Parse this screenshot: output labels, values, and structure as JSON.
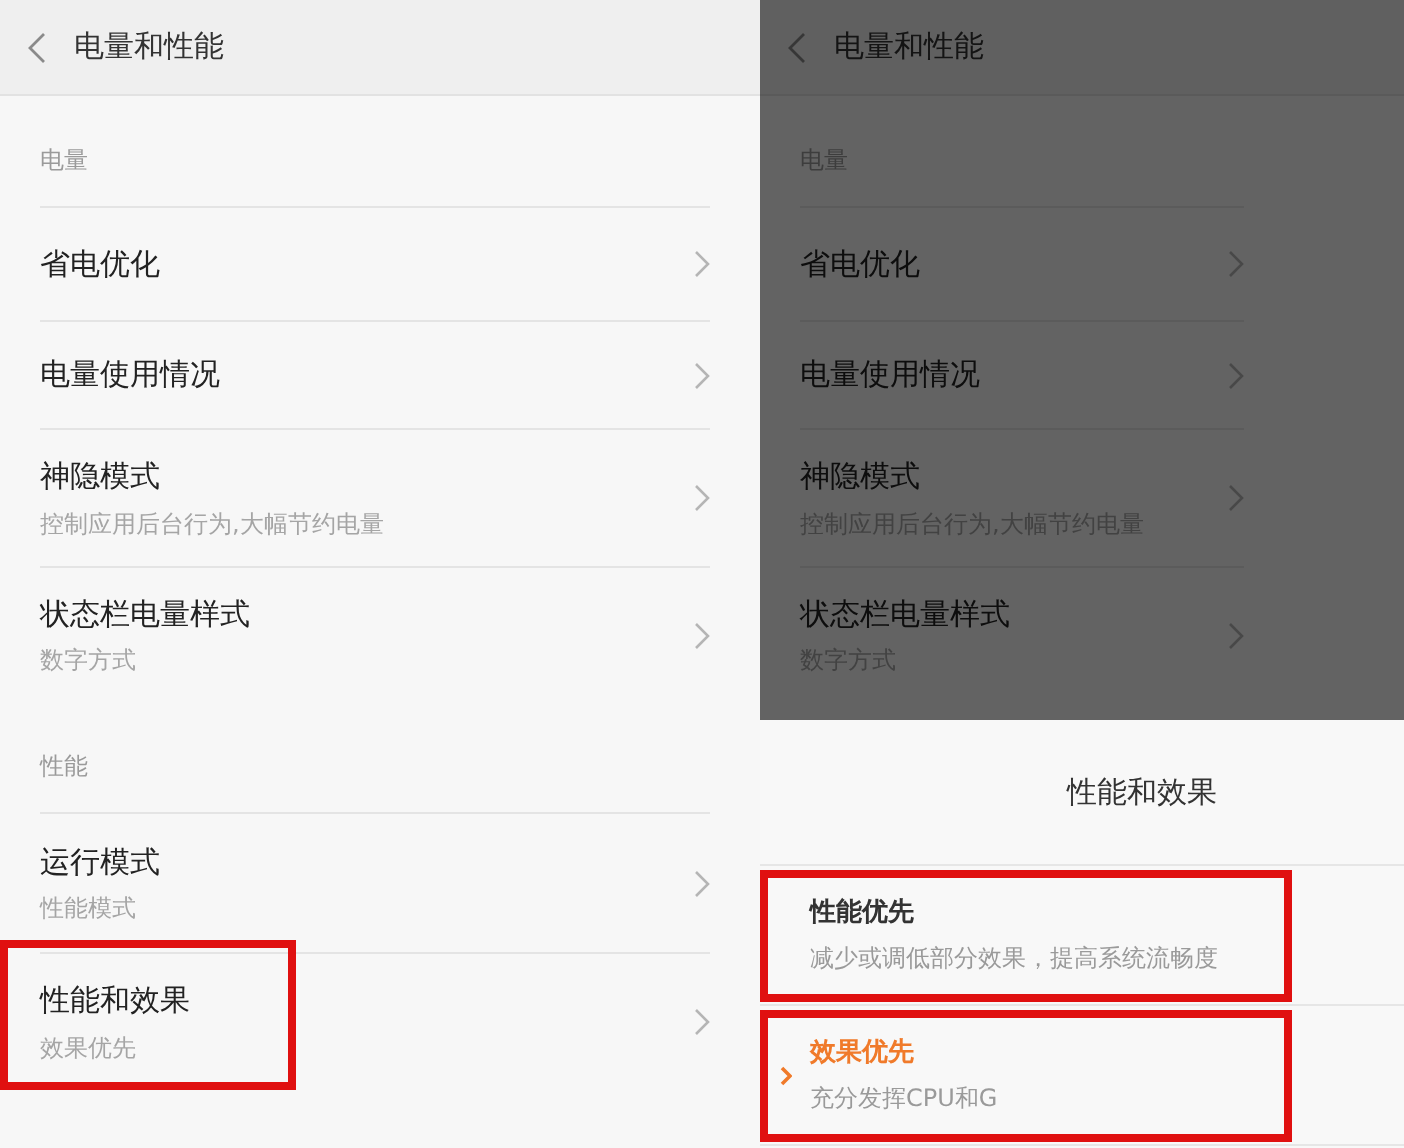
{
  "left_screen": {
    "header": {
      "title": "电量和性能"
    },
    "sections": [
      {
        "label": "电量",
        "items": [
          {
            "title": "省电优化",
            "highlighted": false
          },
          {
            "title": "电量使用情况",
            "highlighted": false
          },
          {
            "title": "神隐模式",
            "subtitle": "控制应用后台行为,大幅节约电量",
            "highlighted": false
          },
          {
            "title": "状态栏电量样式",
            "subtitle": "数字方式",
            "highlighted": false
          }
        ]
      },
      {
        "label": "性能",
        "items": [
          {
            "title": "运行模式",
            "subtitle": "性能模式",
            "highlighted": false
          },
          {
            "title": "性能和效果",
            "subtitle": "效果优先",
            "highlighted": true
          }
        ]
      }
    ]
  },
  "right_screen": {
    "header": {
      "title": "电量和性能"
    },
    "dimmed": true,
    "sections": [
      {
        "label": "电量",
        "items": [
          {
            "title": "省电优化",
            "highlighted": false
          },
          {
            "title": "电量使用情况",
            "highlighted": false
          },
          {
            "title": "神隐模式",
            "subtitle": "控制应用后台行为,大幅节约电量",
            "highlighted": false
          },
          {
            "title": "状态栏电量样式",
            "subtitle": "数字方式",
            "highlighted": false
          }
        ]
      }
    ],
    "sheet": {
      "title": "性能和效果",
      "options": [
        {
          "title": "性能优先",
          "subtitle": "减少或调低部分效果，提高系统流畅度",
          "selected": false,
          "highlighted": true
        },
        {
          "title": "效果优先",
          "subtitle": "充分发挥CPU和G",
          "selected": true,
          "highlighted": true
        }
      ]
    }
  }
}
